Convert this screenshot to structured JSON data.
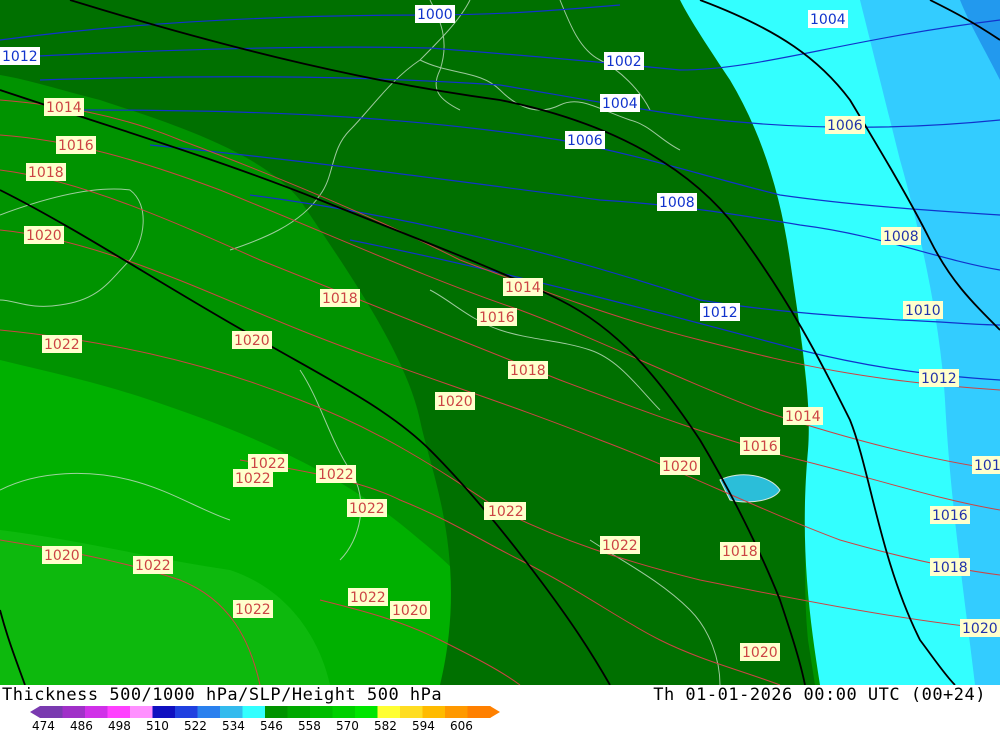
{
  "title": "Thickness 500/1000 hPa/SLP/Height 500 hPa",
  "valid_time": "Th 01-01-2026 00:00 UTC (00+24)",
  "colors": {
    "land_dark": "#007000",
    "land_mid": "#009300",
    "land_light": "#00b000",
    "land_lightest": "#10c020",
    "cyan": "#33ffff",
    "light_blue": "#33ccff",
    "blue": "#2299ee",
    "isobar_blue": "#1133cc",
    "isobar_red": "#cc4444",
    "height_line": "#000000"
  },
  "scale": {
    "colors": [
      "#7a3ab0",
      "#a030c8",
      "#d030e8",
      "#ff40ff",
      "#ff90ff",
      "#1010c0",
      "#2040e0",
      "#2a80ee",
      "#33bbee",
      "#33ffff",
      "#009300",
      "#00a800",
      "#00bd00",
      "#00d000",
      "#00e600",
      "#ffff33",
      "#ffdd22",
      "#ffbb00",
      "#ff9900",
      "#ff8000"
    ],
    "ticks": [
      "474",
      "486",
      "498",
      "510",
      "522",
      "534",
      "546",
      "558",
      "570",
      "582",
      "594",
      "606"
    ]
  },
  "labels": {
    "blue": [
      {
        "text": "1000"
      },
      {
        "text": "1004"
      },
      {
        "text": "1002"
      },
      {
        "text": "1004"
      },
      {
        "text": "1006"
      },
      {
        "text": "1008"
      },
      {
        "text": "1012"
      },
      {
        "text": "1012"
      }
    ],
    "cyan": [
      {
        "text": "1006"
      },
      {
        "text": "1008"
      },
      {
        "text": "1010"
      },
      {
        "text": "1012"
      },
      {
        "text": "1016"
      },
      {
        "text": "1018"
      },
      {
        "text": "1020"
      },
      {
        "text": "101"
      }
    ],
    "red": [
      {
        "text": "1014"
      },
      {
        "text": "1016"
      },
      {
        "text": "1018"
      },
      {
        "text": "1020"
      },
      {
        "text": "1022"
      },
      {
        "text": "1018"
      },
      {
        "text": "1020"
      },
      {
        "text": "1014"
      },
      {
        "text": "1016"
      },
      {
        "text": "1018"
      },
      {
        "text": "1020"
      },
      {
        "text": "1022"
      },
      {
        "text": "1022"
      },
      {
        "text": "1022"
      },
      {
        "text": "1022"
      },
      {
        "text": "1022"
      },
      {
        "text": "1020"
      },
      {
        "text": "1022"
      },
      {
        "text": "1022"
      },
      {
        "text": "1022"
      },
      {
        "text": "1022"
      },
      {
        "text": "1020"
      },
      {
        "text": "1014"
      },
      {
        "text": "1016"
      },
      {
        "text": "1020"
      },
      {
        "text": "1022"
      },
      {
        "text": "1018"
      },
      {
        "text": "1020"
      }
    ]
  }
}
